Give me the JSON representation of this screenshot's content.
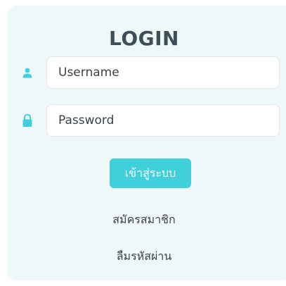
{
  "login": {
    "title": "LOGIN",
    "username": {
      "placeholder": "Username",
      "value": ""
    },
    "password": {
      "placeholder": "Password",
      "value": ""
    },
    "submit_label": "เข้าสู่ระบบ",
    "register_link": "สมัครสมาชิก",
    "forgot_link": "ลืมรหัสผ่าน"
  },
  "colors": {
    "panel_bg": "#eef8f8",
    "accent": "#3fd0dc",
    "text": "#3e4e59"
  },
  "icons": {
    "username": "user-icon",
    "password": "lock-icon"
  }
}
